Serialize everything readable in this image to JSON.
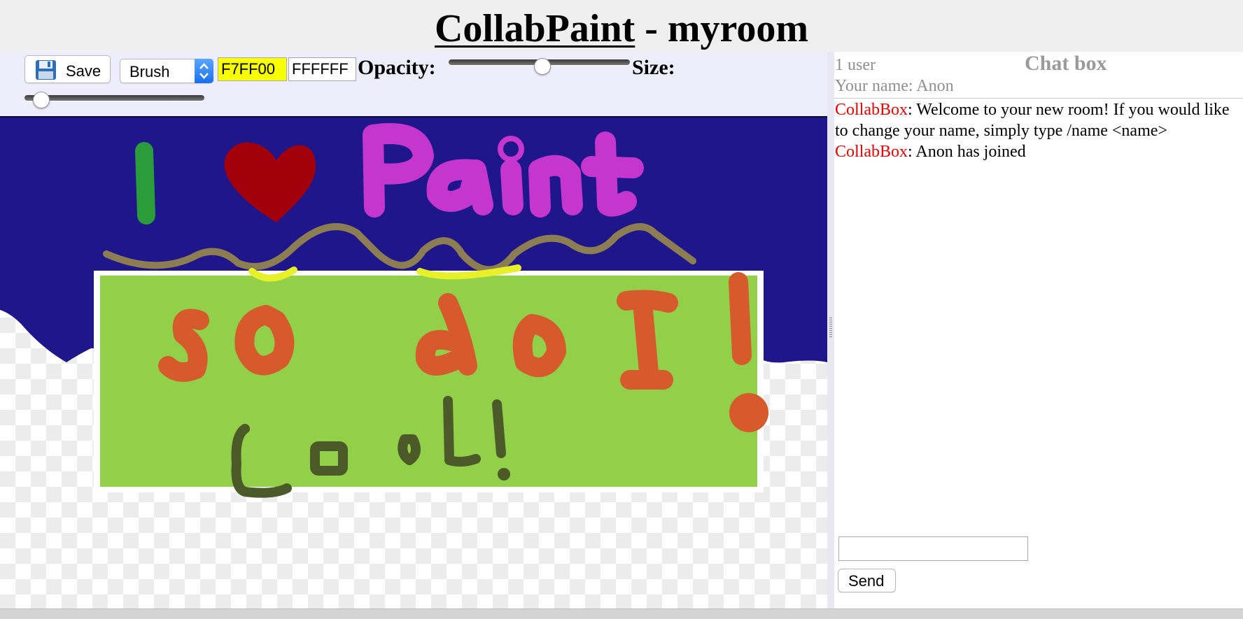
{
  "header": {
    "app_name": "CollabPaint",
    "separator_room": " - myroom"
  },
  "toolbar": {
    "save_label": "Save",
    "tool_selected": "Brush",
    "primary_color": "F7FF00",
    "secondary_color": "FFFFFF",
    "opacity_label": "Opacity:",
    "opacity_value": 0.52,
    "size_label": "Size:",
    "size_value": 0.05
  },
  "chat": {
    "user_count": "1 user",
    "title": "Chat box",
    "your_name": "Your name: Anon",
    "messages": [
      {
        "sender": "CollabBox",
        "text": ": Welcome to your new room! If you would like to change your name, simply type /name <name>"
      },
      {
        "sender": "CollabBox",
        "text": ": Anon has joined"
      }
    ],
    "input_value": "",
    "send_label": "Send"
  },
  "icons": {
    "save": "floppy-disk-icon",
    "select": "updown-arrows-icon"
  }
}
